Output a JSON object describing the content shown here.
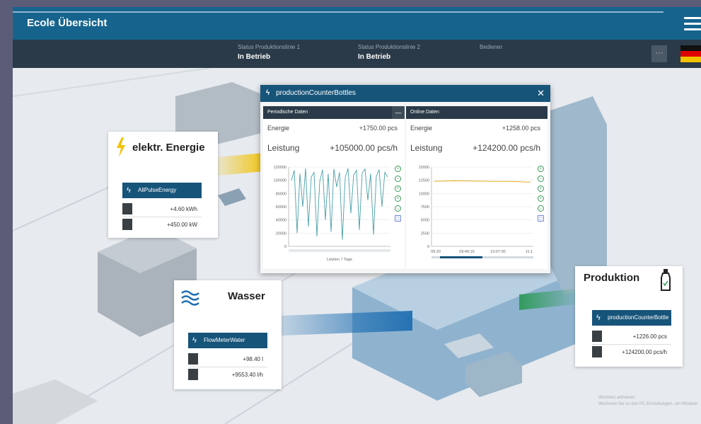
{
  "app": {
    "title": "Ecole Übersicht"
  },
  "status": [
    {
      "label": "Status Produktionslinie 1",
      "value": "In Betrieb"
    },
    {
      "label": "Status Produktionslinie 2",
      "value": "In Betrieb"
    },
    {
      "label": "Bediener",
      "value": ""
    }
  ],
  "more_label": "···",
  "energy": {
    "title": "elektr. Energie",
    "sub": "AllPulseEnergy",
    "values": [
      "+4.60 kWh",
      "+450.00 kW"
    ]
  },
  "water": {
    "title": "Wasser",
    "sub": "FlowMeterWater",
    "values": [
      "+98.40 l",
      "+9553.40 l/h"
    ]
  },
  "production": {
    "title": "Produktion",
    "sub": "productionCounterBottles",
    "values": [
      "+1226.00 pcs",
      "+124200.00 pcs/h"
    ]
  },
  "popup": {
    "title": "productionCounterBottles",
    "close": "✕",
    "periodic": {
      "title": "Periodische Daten",
      "rows": [
        {
          "label": "Energie",
          "value": "+1750.00 pcs"
        },
        {
          "label": "Leistung",
          "value": "+105000.00 pcs/h"
        }
      ],
      "yticks": [
        "120000",
        "100000",
        "80000",
        "60000",
        "40000",
        "20000",
        "0"
      ],
      "footer": "Letzten 7 Tage"
    },
    "online": {
      "title": "Online Daten",
      "rows": [
        {
          "label": "Energie",
          "value": "+1258.00 pcs"
        },
        {
          "label": "Leistung",
          "value": "+124200.00 pcs/h"
        }
      ],
      "yticks": [
        "15000",
        "12500",
        "10000",
        "7500",
        "5000",
        "2500",
        "0"
      ],
      "xticks": [
        "09:20",
        "09:49:16",
        "10:07:00",
        "11:1"
      ]
    }
  },
  "chart_data": [
    {
      "type": "line",
      "title": "Periodische Daten",
      "xlabel": "Letzten 7 Tage",
      "ylim": [
        0,
        120000
      ],
      "series": [
        {
          "values": [
            100000,
            115000,
            20000,
            110000,
            60000,
            118000,
            30000,
            105000,
            112000,
            15000,
            98000,
            116000,
            40000,
            110000,
            22000,
            117000,
            90000,
            112000,
            10000,
            104000,
            118000,
            50000,
            108000,
            115000,
            25000,
            111000,
            117000,
            70000,
            110000,
            18000,
            106000,
            116000,
            60000,
            112000,
            105000
          ]
        }
      ]
    },
    {
      "type": "line",
      "title": "Online Daten",
      "x": [
        "09:20",
        "09:49:16",
        "10:07:00",
        "11:1"
      ],
      "ylim": [
        0,
        15000
      ],
      "series": [
        {
          "values": [
            12300,
            12400,
            12350,
            12300,
            12280,
            12150
          ]
        }
      ]
    }
  ],
  "watermark": [
    "Windows aktivieren",
    "Wechseln Sie zu den PC-Einstellungen, um Windows zu aktivieren."
  ]
}
